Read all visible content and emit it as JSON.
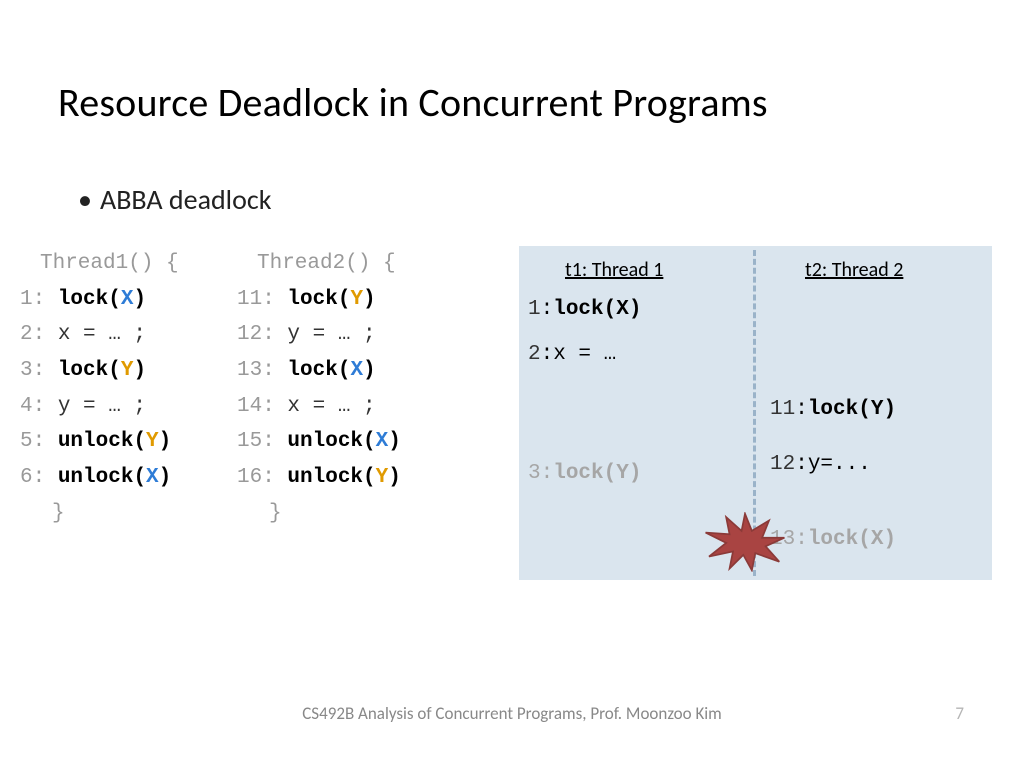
{
  "title": "Resource Deadlock in Concurrent Programs",
  "bullet": "ABBA deadlock",
  "thread1": {
    "header": "Thread1() {",
    "lines": [
      {
        "n": "1:",
        "pre": " ",
        "op": "lock(",
        "var": "X",
        "varclass": "x-var",
        "post": ")",
        "bold": true
      },
      {
        "n": "2:",
        "pre": " x = … ;",
        "op": "",
        "var": "",
        "varclass": "",
        "post": "",
        "bold": false
      },
      {
        "n": "3:",
        "pre": " ",
        "op": "lock(",
        "var": "Y",
        "varclass": "y-var",
        "post": ")",
        "bold": true
      },
      {
        "n": "4:",
        "pre": " y = … ;",
        "op": "",
        "var": "",
        "varclass": "",
        "post": "",
        "bold": false
      },
      {
        "n": "5:",
        "pre": " ",
        "op": "unlock(",
        "var": "Y",
        "varclass": "y-var",
        "post": ")",
        "bold": true
      },
      {
        "n": "6:",
        "pre": " ",
        "op": "unlock(",
        "var": "X",
        "varclass": "x-var",
        "post": ")",
        "bold": true
      }
    ],
    "close": "}"
  },
  "thread2": {
    "header": "Thread2() {",
    "lines": [
      {
        "n": "11:",
        "pre": " ",
        "op": "lock(",
        "var": "Y",
        "varclass": "y-var",
        "post": ")",
        "bold": true
      },
      {
        "n": "12:",
        "pre": " y = … ;",
        "op": "",
        "var": "",
        "varclass": "",
        "post": "",
        "bold": false
      },
      {
        "n": "13:",
        "pre": " ",
        "op": "lock(",
        "var": "X",
        "varclass": "x-var",
        "post": ")",
        "bold": true
      },
      {
        "n": "14:",
        "pre": " x = … ;",
        "op": "",
        "var": "",
        "varclass": "",
        "post": "",
        "bold": false
      },
      {
        "n": "15:",
        "pre": " ",
        "op": "unlock(",
        "var": "X",
        "varclass": "x-var",
        "post": ")",
        "bold": true
      },
      {
        "n": "16:",
        "pre": " ",
        "op": "unlock(",
        "var": "Y",
        "varclass": "y-var",
        "post": ")",
        "bold": true
      }
    ],
    "close": "}"
  },
  "exec": {
    "col1": "t1: Thread 1",
    "col2": "t2: Thread 2",
    "t1": [
      {
        "n": "1",
        "text": ":",
        "b": "lock(X)",
        "gray": false
      },
      {
        "n": "2",
        "text": ":x = …",
        "b": "",
        "gray": false
      },
      {
        "n": "3",
        "text": ":",
        "b": "lock(Y)",
        "gray": true
      }
    ],
    "t2": [
      {
        "n": "11",
        "text": ":",
        "b": "lock(Y)",
        "gray": false
      },
      {
        "n": "12",
        "text": ":y=...",
        "b": "",
        "gray": false
      },
      {
        "n": "13",
        "text": ":",
        "b": "lock(X)",
        "gray": true
      }
    ]
  },
  "footer": "CS492B Analysis of Concurrent Programs, Prof. Moonzoo Kim",
  "page": "7"
}
